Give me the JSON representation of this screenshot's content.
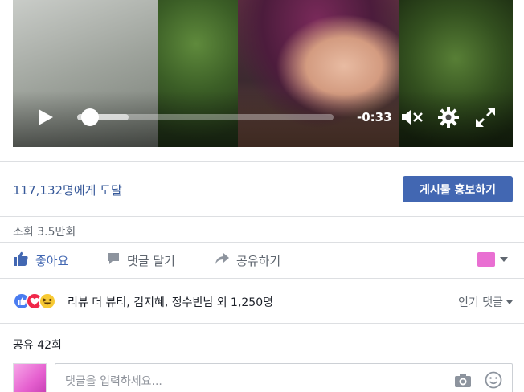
{
  "video": {
    "time_remaining": "-0:33",
    "progress_fraction": 0.05,
    "buffered_fraction": 0.2,
    "icons": {
      "play": "play-icon",
      "mute": "volume-muted-icon",
      "settings": "gear-icon",
      "fullscreen": "fullscreen-icon"
    }
  },
  "stats": {
    "reach": "117,132명에게 도달",
    "boost_label": "게시물 홍보하기",
    "views": "조회 3.5만회"
  },
  "actions": {
    "like": "좋아요",
    "comment": "댓글 달기",
    "share": "공유하기"
  },
  "reactions": {
    "summary": "리뷰 더 뷰티, 김지혜, 정수빈님 외 1,250명",
    "sort_label": "인기 댓글",
    "types": [
      "like",
      "love",
      "haha"
    ]
  },
  "shares": {
    "label": "공유 42회"
  },
  "composer": {
    "placeholder": "댓글을 입력하세요..."
  },
  "colors": {
    "brand": "#4267b2",
    "link": "#365899",
    "muted": "#606770"
  }
}
